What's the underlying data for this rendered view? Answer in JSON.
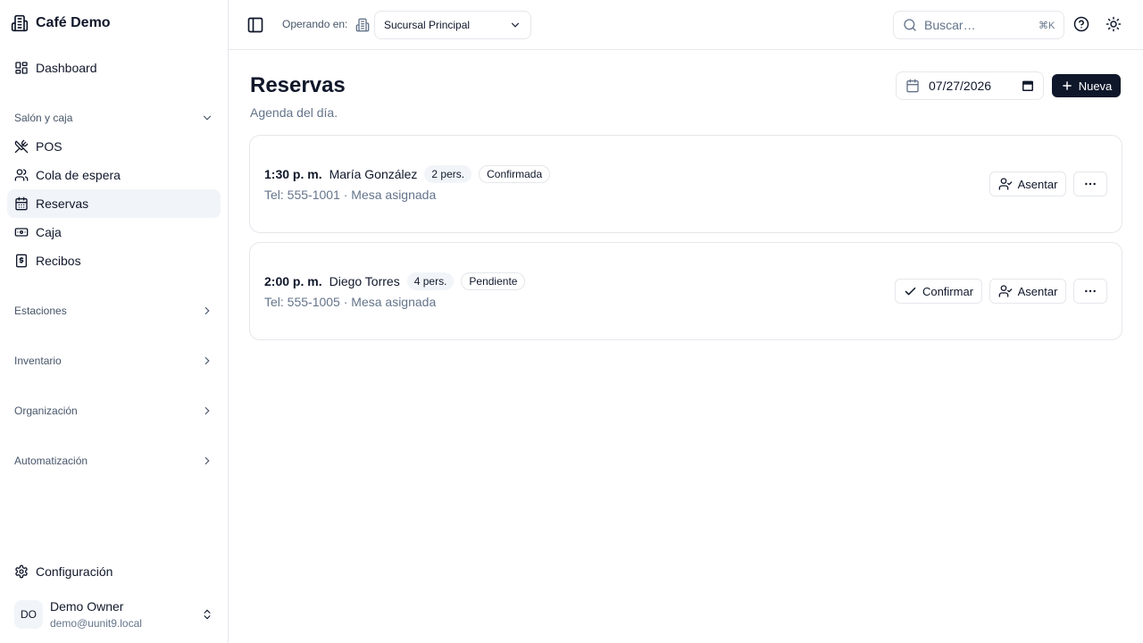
{
  "sidebar": {
    "brand": "Café Demo",
    "dashboard": "Dashboard",
    "groups": {
      "salon": "Salón y caja",
      "estaciones": "Estaciones",
      "inventario": "Inventario",
      "organizacion": "Organización",
      "automatizacion": "Automatización"
    },
    "items": [
      "POS",
      "Cola de espera",
      "Reservas",
      "Caja",
      "Recibos"
    ],
    "active_item": "Reservas",
    "settings": "Configuración",
    "user": {
      "initials": "DO",
      "name": "Demo Owner",
      "email": "demo@uunit9.local"
    }
  },
  "header": {
    "operating_label": "Operando en:",
    "branch": "Sucursal Principal",
    "search_placeholder": "Buscar…",
    "search_shortcut": "⌘K"
  },
  "page": {
    "title": "Reservas",
    "subtitle": "Agenda del día.",
    "date": "07/27/2026",
    "new_label": "Nueva"
  },
  "reservations": [
    {
      "time": "1:30 p. m.",
      "name": "María González",
      "party": "2 pers.",
      "status": "Confirmada",
      "meta": "Tel: 555-1001 · Mesa asignada",
      "seat_label": "Asentar"
    },
    {
      "time": "2:00 p. m.",
      "name": "Diego Torres",
      "party": "4 pers.",
      "status": "Pendiente",
      "meta": "Tel: 555-1005 · Mesa asignada",
      "confirm_label": "Confirmar",
      "seat_label": "Asentar"
    }
  ],
  "colors": {
    "primary": "#0f172a",
    "muted": "#64748b",
    "border": "#e5e7eb",
    "active_bg": "#f1f5f9"
  }
}
